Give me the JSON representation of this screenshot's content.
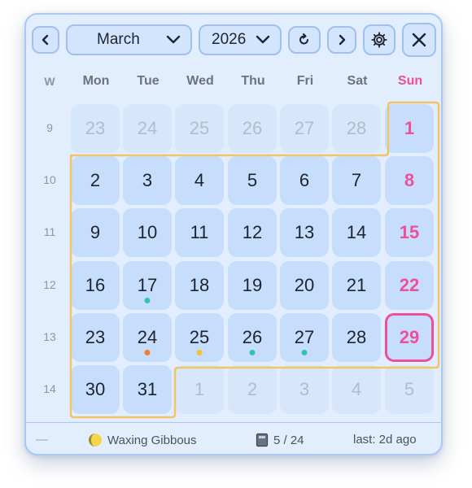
{
  "toolbar": {
    "prev_icon": "chevron-left-icon",
    "month": "March",
    "year": "2026",
    "today_icon": "reset-icon",
    "next_icon": "chevron-right-icon",
    "settings_icon": "gear-icon",
    "close_icon": "close-icon"
  },
  "weekdays": [
    "W",
    "Mon",
    "Tue",
    "Wed",
    "Thu",
    "Fri",
    "Sat",
    "Sun"
  ],
  "weeks": [
    {
      "week": "9",
      "days": [
        "23",
        "24",
        "25",
        "26",
        "27",
        "28",
        "1"
      ]
    },
    {
      "week": "10",
      "days": [
        "2",
        "3",
        "4",
        "5",
        "6",
        "7",
        "8"
      ]
    },
    {
      "week": "11",
      "days": [
        "9",
        "10",
        "11",
        "12",
        "13",
        "14",
        "15"
      ]
    },
    {
      "week": "12",
      "days": [
        "16",
        "17",
        "18",
        "19",
        "20",
        "21",
        "22"
      ]
    },
    {
      "week": "13",
      "days": [
        "23",
        "24",
        "25",
        "26",
        "27",
        "28",
        "29"
      ]
    },
    {
      "week": "14",
      "days": [
        "30",
        "31",
        "1",
        "2",
        "3",
        "4",
        "5"
      ]
    }
  ],
  "today": "29",
  "event_dots": [
    {
      "day": "17",
      "color": "#2ec4b6"
    },
    {
      "day": "24",
      "color": "#f07e2e"
    },
    {
      "day": "25",
      "color": "#f2c230"
    },
    {
      "day": "26",
      "color": "#2ec4b6"
    },
    {
      "day": "27",
      "color": "#2ec4b6"
    }
  ],
  "colors": {
    "sunday": "#ee4f9a",
    "month_outline": "#f1c36b",
    "cell": "#c6defc"
  },
  "footer": {
    "dash": "—",
    "moon_icon": "moon-phase-icon",
    "moon_phase": "Waxing Gibbous",
    "book_icon": "book-icon",
    "progress": "5 / 24",
    "last": "last: 2d ago"
  }
}
